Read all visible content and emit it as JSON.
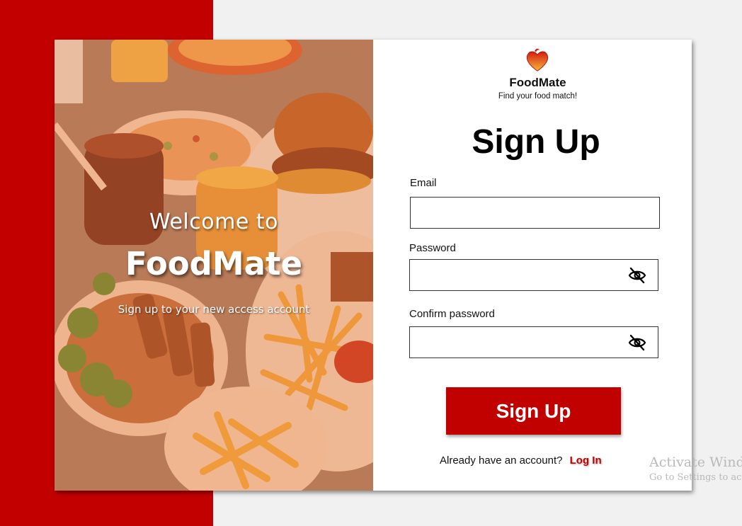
{
  "brand": {
    "name": "FoodMate",
    "tagline": "Find your food match!",
    "logo_icon": "heart-flame-icon",
    "accent_color": "#c20000"
  },
  "hero": {
    "welcome": "Welcome to",
    "title": "FoodMate",
    "subtitle": "Sign up to your new access account",
    "image": "food-spread-photo"
  },
  "form": {
    "title": "Sign Up",
    "email": {
      "label": "Email",
      "value": "",
      "placeholder": ""
    },
    "password": {
      "label": "Password",
      "value": "",
      "placeholder": "",
      "toggle_icon": "eye-off-icon"
    },
    "confirm_password": {
      "label": "Confirm password",
      "value": "",
      "placeholder": "",
      "toggle_icon": "eye-off-icon"
    },
    "submit_label": "Sign Up",
    "login_prompt": "Already have an account?",
    "login_link": "Log In"
  },
  "watermark": {
    "title": "Activate Windo",
    "subtitle": "Go to Settings to ac"
  }
}
